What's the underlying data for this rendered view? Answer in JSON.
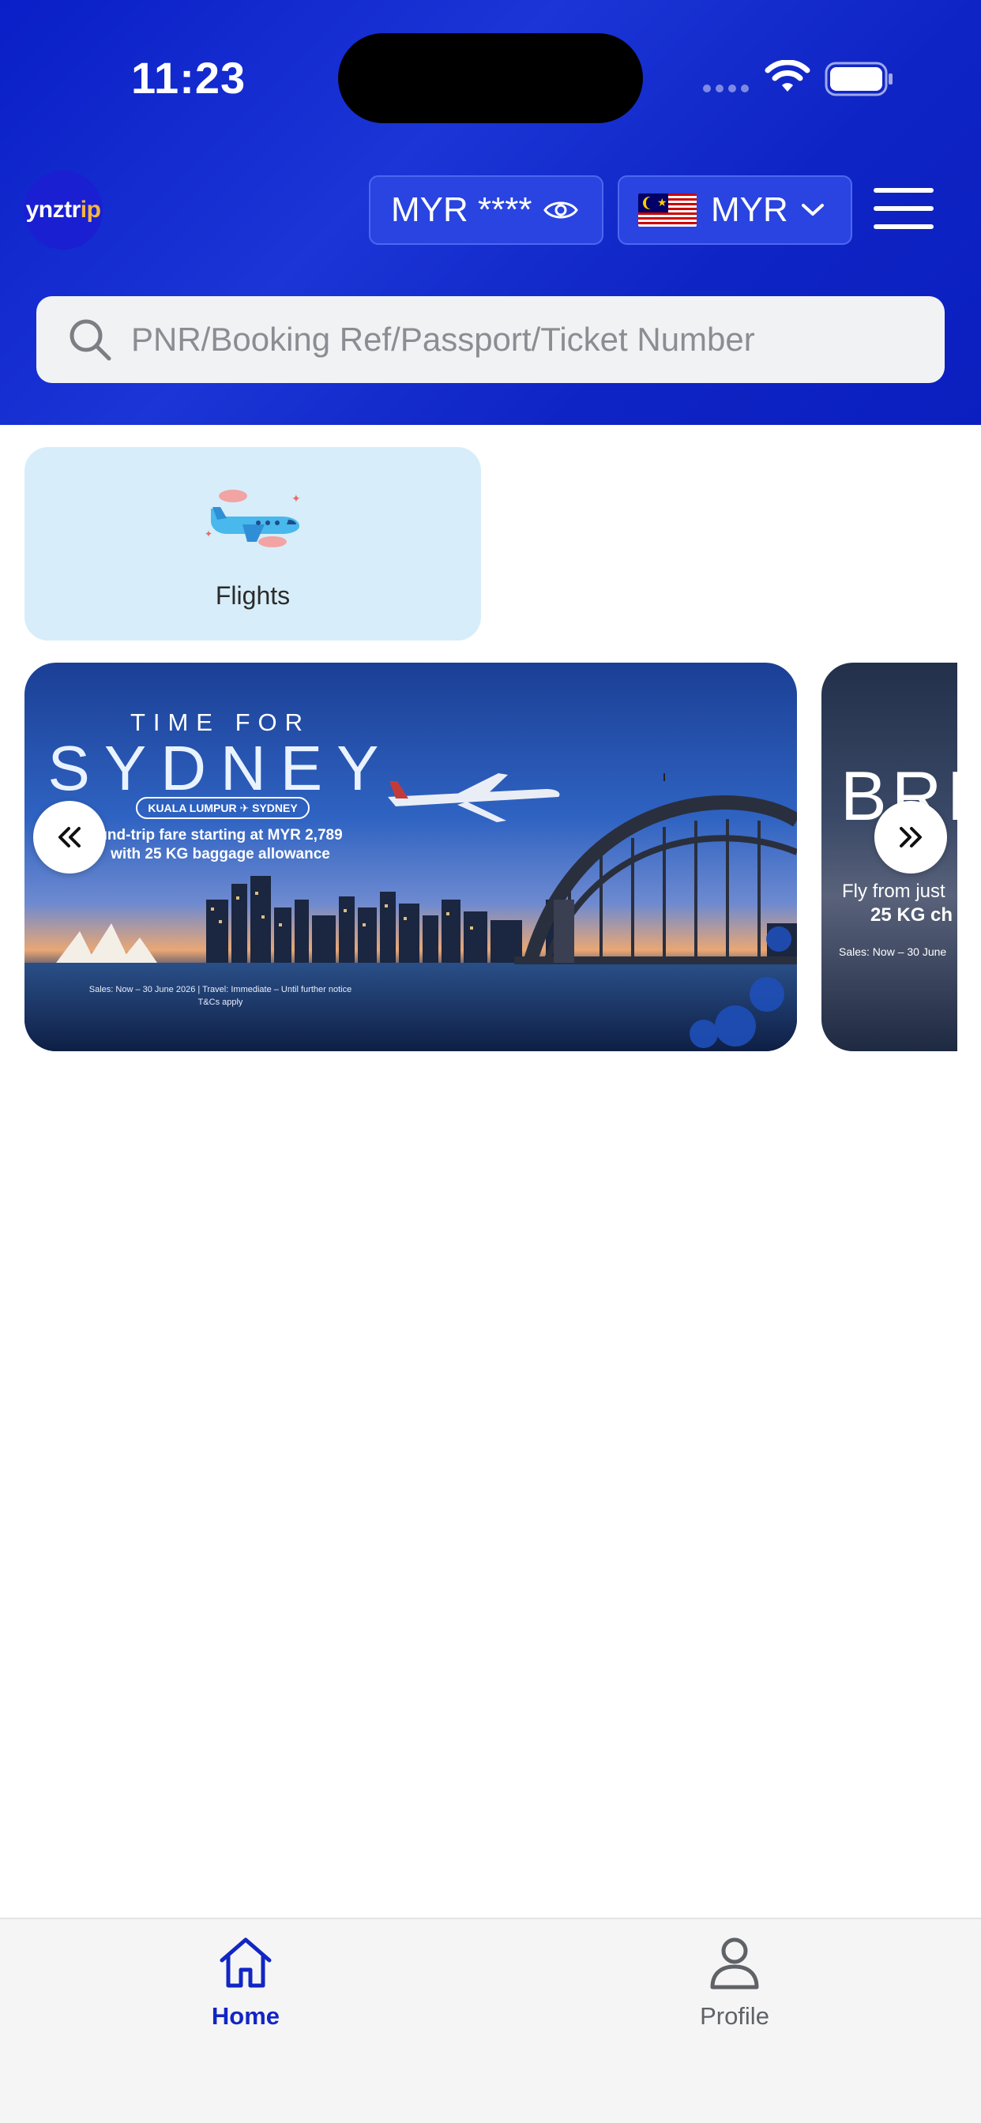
{
  "status_bar": {
    "time": "11:23"
  },
  "header": {
    "logo_text_main": "ynztr",
    "logo_text_accent": "ip",
    "balance_label": "MYR ****",
    "currency_label": "MYR",
    "search_placeholder": "PNR/Booking Ref/Passport/Ticket Number"
  },
  "services": [
    {
      "label": "Flights",
      "icon": "airplane-icon"
    }
  ],
  "banners": [
    {
      "kicker": "TIME FOR",
      "headline": "SYDNEY",
      "route": "KUALA LUMPUR ✈ SYDNEY",
      "line1": "und-trip fare starting at MYR 2,789",
      "line2": "with 25 KG baggage allowance",
      "fine1": "Sales: Now – 30 June 2026 | Travel: Immediate – Until further notice",
      "fine2": "T&Cs apply"
    },
    {
      "headline": "BRI",
      "line1": "Fly from just",
      "line2": "25 KG ch",
      "fine": "Sales: Now – 30 June"
    }
  ],
  "tabbar": {
    "items": [
      {
        "label": "Home",
        "icon": "home-icon",
        "active": true
      },
      {
        "label": "Profile",
        "icon": "profile-icon",
        "active": false
      }
    ]
  },
  "colors": {
    "brand_blue": "#0a1fc7",
    "active_tab": "#1226c3",
    "card_bg": "#d7edf9"
  }
}
